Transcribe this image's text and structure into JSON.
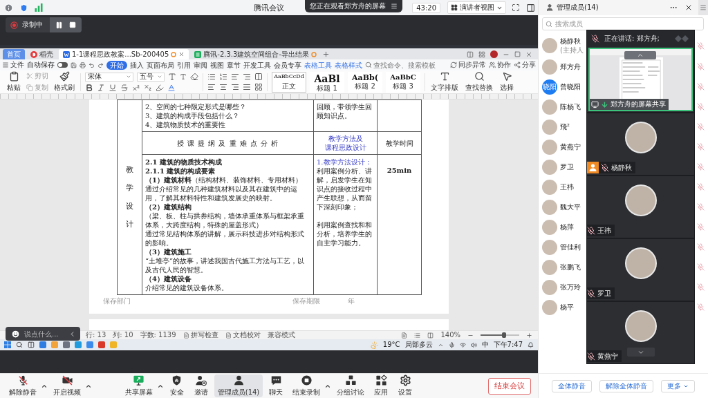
{
  "window": {
    "title": "腾讯会议",
    "banner": "您正在观看郑方舟的屏幕",
    "timer": "43:20",
    "view_mode": "演讲者视图"
  },
  "recording": {
    "label": "录制中"
  },
  "shared_screen": {
    "tabs": [
      {
        "label": "首页",
        "kind": "home",
        "selected": false
      },
      {
        "label": "稻壳",
        "kind": "store",
        "selected": false
      },
      {
        "label": "1-1课程思政教案...Sb-200405",
        "kind": "writer",
        "selected": true
      },
      {
        "label": "腾讯-2.3.3建筑空间组合-导出结果",
        "kind": "sheet",
        "selected": false
      }
    ],
    "menu": {
      "file": "文件",
      "autosave": {
        "label": "自动保存",
        "on": false
      },
      "tabs": [
        {
          "label": "开始",
          "kind": "main",
          "selected": true
        },
        {
          "label": "插入",
          "kind": "main",
          "selected": false
        },
        {
          "label": "页面布局",
          "kind": "main",
          "selected": false
        },
        {
          "label": "引用",
          "kind": "main",
          "selected": false
        },
        {
          "label": "审阅",
          "kind": "main",
          "selected": false
        },
        {
          "label": "视图",
          "kind": "main",
          "selected": false
        },
        {
          "label": "章节",
          "kind": "main",
          "selected": false
        },
        {
          "label": "开发工具",
          "kind": "main",
          "selected": false
        },
        {
          "label": "会员专享",
          "kind": "main",
          "selected": false
        },
        {
          "label": "表格工具",
          "kind": "contextual",
          "selected": false
        },
        {
          "label": "表格样式",
          "kind": "contextual",
          "selected": false
        }
      ],
      "search": {
        "placeholder": "查找命令、搜索模板"
      },
      "actions": [
        {
          "label": "同步异常",
          "kind": "sync"
        },
        {
          "label": "协作",
          "kind": "collaborate"
        },
        {
          "label": "分享",
          "kind": "share"
        }
      ]
    },
    "ribbon": {
      "paste": "粘贴",
      "cut": "剪切",
      "copy": "复制",
      "format_painter": "格式刷",
      "font": "宋体",
      "size": "五号",
      "styles": [
        {
          "sample": "AaBbCcDd",
          "label": "正文",
          "kind": "body"
        },
        {
          "sample": "AaBl",
          "label": "标题 1",
          "kind": "heading1"
        },
        {
          "sample": "AaBb(",
          "label": "标题 2",
          "kind": "heading2"
        },
        {
          "sample": "AaBbC",
          "label": "标题 3",
          "kind": "heading3"
        }
      ],
      "tools": [
        {
          "label": "文字排版",
          "kind": "layout"
        },
        {
          "label": "查找替换",
          "kind": "find"
        },
        {
          "label": "选择",
          "kind": "select"
        }
      ]
    },
    "document": {
      "intro_row": {
        "questions": [
          "2、空间的七种限定形式是哪些？",
          "3、建筑的构成手段包括什么？",
          "4、建筑物质技术的重要性"
        ],
        "method": "回顾，带领学生回顾知识点。"
      },
      "header": {
        "outline": "授 课 提 纲 及 重 难 点 分 析",
        "method_lines": [
          "教学方法及",
          "课程思政设计"
        ],
        "time": "教学时间"
      },
      "section_label": "教学设计",
      "content": [
        {
          "kind": "heading",
          "text": "2.1 建筑的物质技术构成"
        },
        {
          "kind": "heading",
          "text": "2.1.1 建筑的构成要素"
        },
        {
          "kind": "body",
          "text": "**（1）建筑材料**（结构材料、装饰材料、专用材料）"
        },
        {
          "kind": "body",
          "text": "通过介绍常见的几种建筑材料以及其在建筑中的运用，了解其材料特性和建筑发展史的映射。"
        },
        {
          "kind": "heading",
          "text": "（2）建筑结构"
        },
        {
          "kind": "body",
          "text": "（梁、板、柱与拱券结构，墙体承重体系与框架承重体系，大跨度结构，特殊的屋盖形式）"
        },
        {
          "kind": "body",
          "text": "通过常见结构体系的讲解，展示科技进步对结构形式的影响。"
        },
        {
          "kind": "heading",
          "text": "（3）建筑施工"
        },
        {
          "kind": "body",
          "text": "“土堆亭”的故事，讲述我国古代施工方法与工艺，以及古代人民的智慧。"
        },
        {
          "kind": "heading",
          "text": "（4）建筑设备"
        },
        {
          "kind": "body",
          "text": "介绍常见的建筑设备体系。"
        }
      ],
      "methods": [
        {
          "kind": "title",
          "text": "1.教学方法设计："
        },
        {
          "kind": "body",
          "text": "利用案例分析、讲解，启发学生在知识点的接收过程中产生联想，从而留下深刻印象；"
        },
        {
          "kind": "body",
          "text": "利用案例查找和和分析，培养学生的自主学习能力。"
        }
      ],
      "time": "25min",
      "footer": {
        "department": "保存部门",
        "period": "保存期限",
        "year": "年"
      }
    },
    "status_bar": {
      "items": [
        "行: 13",
        "列: 10",
        "字数: 1139"
      ],
      "checks": [
        "拼写检查",
        "文档校对"
      ],
      "mode": "兼容模式",
      "zoom": {
        "label": "140%",
        "level": 0.6
      }
    },
    "taskbar": {
      "temperature": "19°C",
      "weather": "局部多云",
      "ime": "中",
      "time": "下午7:47"
    }
  },
  "chat_input": {
    "placeholder": "说点什么..."
  },
  "toolbar": {
    "left": [
      {
        "label": "解除静音",
        "kind": "mic_off",
        "caret": true,
        "selected": false
      },
      {
        "label": "开启视频",
        "kind": "video_off",
        "caret": true,
        "selected": false
      }
    ],
    "center": [
      {
        "label": "共享屏幕",
        "kind": "share",
        "caret": true,
        "selected": false
      },
      {
        "label": "安全",
        "kind": "security",
        "caret": false,
        "selected": false
      },
      {
        "label": "邀请",
        "kind": "invite",
        "caret": false,
        "selected": false
      },
      {
        "label": "管理成员(14)",
        "kind": "members",
        "caret": false,
        "selected": true
      },
      {
        "label": "聊天",
        "kind": "chat",
        "caret": false,
        "selected": false
      },
      {
        "label": "结束录制",
        "kind": "stop_record",
        "caret": true,
        "selected": false
      },
      {
        "label": "分组讨论",
        "kind": "breakout",
        "caret": false,
        "selected": false
      },
      {
        "label": "应用",
        "kind": "apps",
        "caret": false,
        "selected": false
      },
      {
        "label": "设置",
        "kind": "settings",
        "caret": false,
        "selected": false
      }
    ],
    "end_button": "结束会议"
  },
  "members_panel": {
    "title": "管理成员(14)",
    "search": {
      "placeholder": "搜索成员"
    },
    "members": [
      {
        "name": "杨静秋",
        "role": "(主持人",
        "avatar": {
          "kind": "photo"
        },
        "muted": true
      },
      {
        "name": "郑方舟",
        "avatar": {
          "kind": "photo"
        },
        "muted": true
      },
      {
        "name": "曾晓阳",
        "avatar": {
          "kind": "initials",
          "text": "晓阳"
        },
        "muted": true
      },
      {
        "name": "陈杨飞",
        "avatar": {
          "kind": "photo"
        },
        "muted": true
      },
      {
        "name": "飛²",
        "avatar": {
          "kind": "photo"
        },
        "muted": true
      },
      {
        "name": "黄燕宁",
        "avatar": {
          "kind": "photo"
        },
        "muted": true
      },
      {
        "name": "罗卫",
        "avatar": {
          "kind": "photo"
        },
        "muted": true
      },
      {
        "name": "王祎",
        "avatar": {
          "kind": "photo"
        },
        "muted": true
      },
      {
        "name": "魏大平",
        "avatar": {
          "kind": "photo"
        },
        "muted": true
      },
      {
        "name": "杨萍",
        "avatar": {
          "kind": "photo"
        },
        "muted": true
      },
      {
        "name": "管佳利",
        "avatar": {
          "kind": "photo"
        },
        "muted": true
      },
      {
        "name": "张鹏飞",
        "avatar": {
          "kind": "photo"
        },
        "muted": true
      },
      {
        "name": "张万玲",
        "avatar": {
          "kind": "photo"
        },
        "muted": true
      },
      {
        "name": "杨平",
        "avatar": {
          "kind": "photo"
        },
        "muted": true
      }
    ],
    "buttons": [
      {
        "label": "全体静音",
        "kind": "mute_all"
      },
      {
        "label": "解除全体静音",
        "kind": "unmute_all"
      },
      {
        "label": "更多",
        "kind": "more"
      }
    ]
  },
  "video_panel": {
    "speaking": "正在讲话: 郑方舟;",
    "screen_share": "郑方舟的屏幕共享",
    "tiles": [
      {
        "name": "杨静秋",
        "host": true,
        "muted": true
      },
      {
        "name": "王祎",
        "host": false,
        "muted": true
      },
      {
        "name": "罗卫",
        "host": false,
        "muted": true
      },
      {
        "name": "黄燕宁",
        "host": false,
        "muted": true
      }
    ]
  }
}
